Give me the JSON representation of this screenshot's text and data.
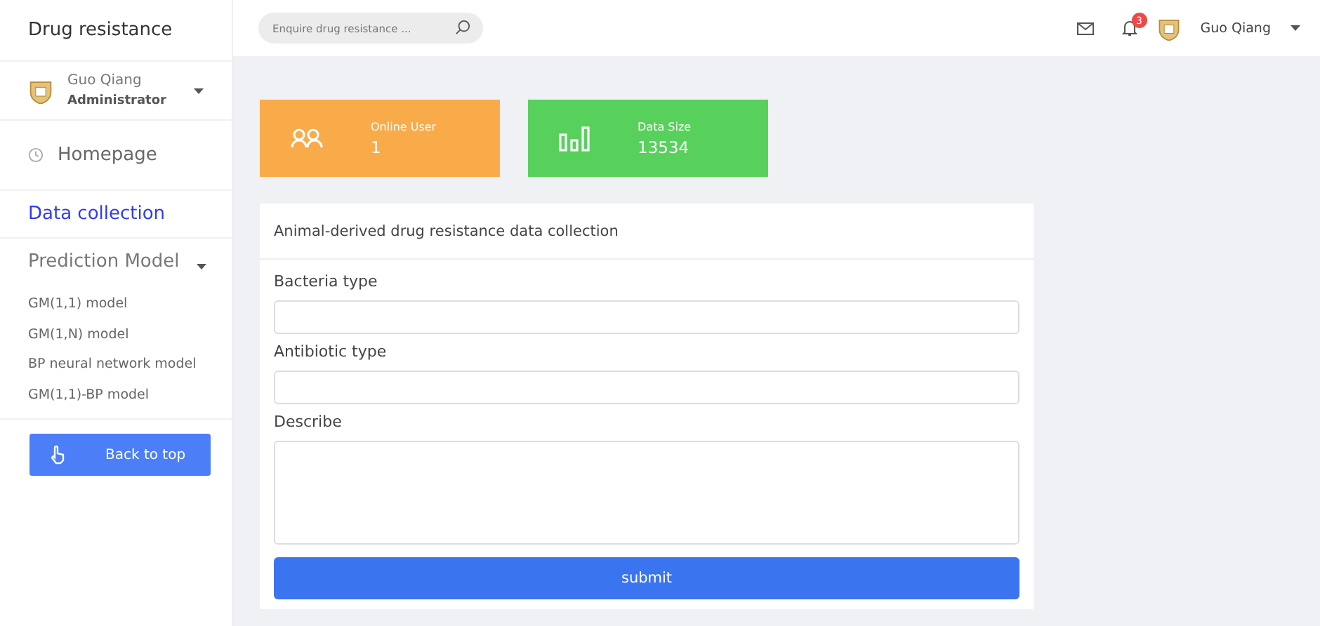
{
  "sidebar": {
    "title": "Drug resistance",
    "user": {
      "name": "Guo Qiang",
      "role": "Administrator"
    },
    "items": [
      {
        "kind": "link",
        "label": "Homepage",
        "selected": false
      },
      {
        "kind": "link",
        "label": "Data collection",
        "selected": true
      },
      {
        "kind": "group",
        "label": "Prediction Model",
        "expanded": true,
        "children": [
          {
            "label": "GM(1,1) model"
          },
          {
            "label": "GM(1,N) model"
          },
          {
            "label": "BP neural network model"
          },
          {
            "label": "GM(1,1)-BP model"
          }
        ]
      }
    ],
    "back_button": "Back to top"
  },
  "topbar": {
    "search": {
      "placeholder": "Enquire drug resistance ..."
    },
    "notifications": "3",
    "user": "Guo Qiang"
  },
  "stats": [
    {
      "kind": "users",
      "label": "Online User",
      "value": "1",
      "color": "#f9ab4a"
    },
    {
      "kind": "size",
      "label": "Data Size",
      "value": "13534",
      "color": "#58d05c"
    }
  ],
  "form": {
    "title": "Animal-derived drug resistance data collection",
    "fields": [
      {
        "kind": "input",
        "label": "Bacteria type"
      },
      {
        "kind": "input",
        "label": "Antibiotic type"
      },
      {
        "kind": "textarea",
        "label": "Describe"
      }
    ],
    "submit": "submit"
  }
}
